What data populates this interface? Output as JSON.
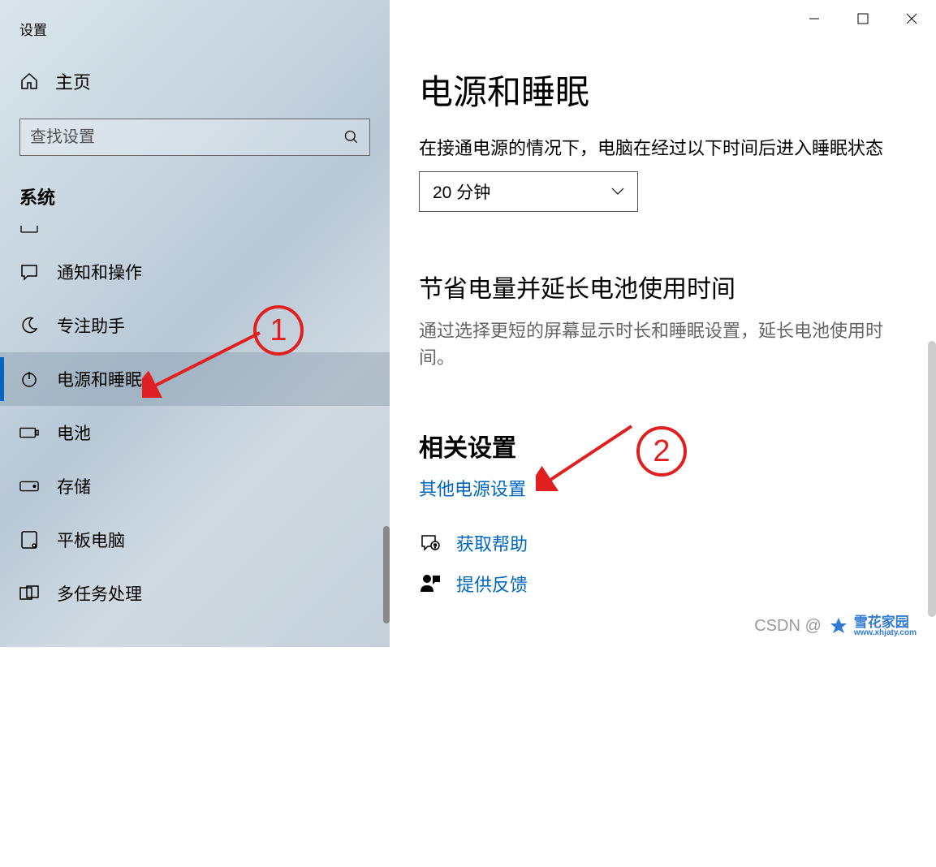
{
  "window": {
    "title": "设置"
  },
  "sidebar": {
    "home": "主页",
    "search_placeholder": "查找设置",
    "category": "系统",
    "items": [
      {
        "label": "通知和操作"
      },
      {
        "label": "专注助手"
      },
      {
        "label": "电源和睡眠"
      },
      {
        "label": "电池"
      },
      {
        "label": "存储"
      },
      {
        "label": "平板电脑"
      },
      {
        "label": "多任务处理"
      }
    ]
  },
  "main": {
    "title": "电源和睡眠",
    "sleep_label": "在接通电源的情况下，电脑在经过以下时间后进入睡眠状态",
    "sleep_value": "20 分钟",
    "save_title": "节省电量并延长电池使用时间",
    "save_text": "通过选择更短的屏幕显示时长和睡眠设置，延长电池使用时间。",
    "related_title": "相关设置",
    "related_link": "其他电源设置",
    "help_link": "获取帮助",
    "feedback_link": "提供反馈"
  },
  "annotations": {
    "one": "1",
    "two": "2"
  },
  "watermark": {
    "csdn": "CSDN @",
    "brand": "雪花家园",
    "url": "www.xhjaty.com"
  }
}
